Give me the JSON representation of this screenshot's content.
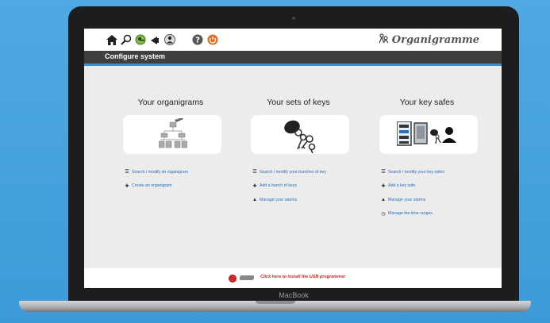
{
  "device": {
    "label": "MacBook"
  },
  "toolbar": {
    "icons": [
      "home-icon",
      "search-icon",
      "key-icon",
      "alarm-icon",
      "user-icon",
      "help-icon",
      "power-icon"
    ],
    "brand": "Organigramme"
  },
  "titlebar": {
    "title": "Configure system"
  },
  "columns": [
    {
      "title": "Your organigrams",
      "links": [
        {
          "icon": "list-icon",
          "label": "Search / modify an organigram"
        },
        {
          "icon": "plus-icon",
          "label": "Create an organigram"
        }
      ]
    },
    {
      "title": "Your sets of keys",
      "links": [
        {
          "icon": "list-icon",
          "label": "Search / modify your bunches of key"
        },
        {
          "icon": "plus-icon",
          "label": "Add a bunch of keys"
        },
        {
          "icon": "bell-icon",
          "label": "Manage your alarms"
        }
      ]
    },
    {
      "title": "Your key safes",
      "links": [
        {
          "icon": "list-icon",
          "label": "Search / modify your key safes"
        },
        {
          "icon": "plus-icon",
          "label": "Add a key safe"
        },
        {
          "icon": "bell-icon",
          "label": "Manage your alarms"
        },
        {
          "icon": "clock-icon",
          "label": "Manage the time ranges"
        }
      ]
    }
  ],
  "footer": {
    "text": "Click here to install the USB programmer"
  },
  "colors": {
    "accent": "#3a8fcf",
    "link": "#2a6ebb",
    "footer_text": "#c52a2a",
    "titlebar": "#3f3f3f"
  }
}
